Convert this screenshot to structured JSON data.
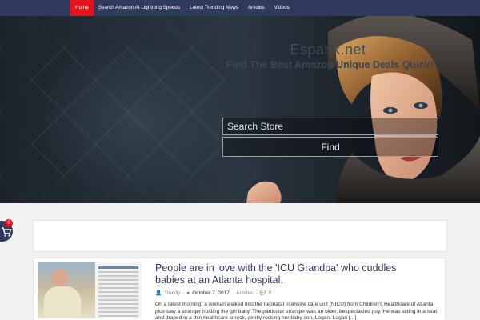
{
  "nav": {
    "items": [
      {
        "label": "Home",
        "active": true
      },
      {
        "label": "Search Amazon At Lightning Speeds",
        "active": false
      },
      {
        "label": "Latest Trending News",
        "active": false
      },
      {
        "label": "Articles",
        "active": false
      },
      {
        "label": "Videos",
        "active": false
      }
    ]
  },
  "hero": {
    "site_title": "Espank.net",
    "tagline": "Find The Best Amazon Unique Deals Quick!",
    "search_placeholder": "Search Store",
    "find_label": "Find"
  },
  "cart": {
    "count": "0",
    "icon": "cart-icon"
  },
  "post": {
    "title": "People are in love with the 'ICU Grandpa' who cuddles babies at an Atlanta hospital.",
    "author": "Trendy",
    "date": "October 7, 2017",
    "category": "Articles",
    "comments": "0",
    "excerpt": "On a latest morning, a woman walked into the neonatal intensive care unit (NICU) from Children's Healthcare of Atlanta plus saw a stranger holding the girl baby. The particular stranger was an older, bespectacled guy. He was sitting in a seat and draped in a thin healthcare smock, gently rocking her baby son, Logan. Logan [...]"
  },
  "colors": {
    "nav_bg": "#2f3a5d",
    "active": "#e4121b",
    "title": "#2f3a5d"
  }
}
